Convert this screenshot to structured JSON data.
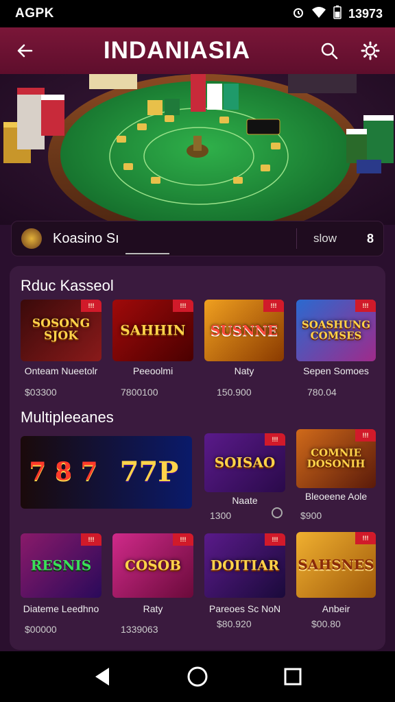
{
  "status_bar": {
    "carrier": "AGPK",
    "time": "13973"
  },
  "app_bar": {
    "title": "INDANIASIA"
  },
  "search": {
    "label": "Koasino Sı",
    "sort": "slow",
    "count": "8"
  },
  "sections": [
    {
      "title": "Rduc Kasseol",
      "games": [
        {
          "logo": "SOSONG\nSJOK",
          "badge": "!!!",
          "name": "Onteam Nueetolr",
          "price": "$03300"
        },
        {
          "logo": "SAHHIN",
          "badge": "!!!",
          "name": "Peeoolmi",
          "price": "7800100"
        },
        {
          "logo": "SUSNNE",
          "badge": "!!!",
          "name": "Naty",
          "price": "150.900"
        },
        {
          "logo": "SOASHUNG\nCOMSES",
          "badge": "!!!",
          "name": "Sepen Somoes",
          "price": "780.04"
        }
      ]
    },
    {
      "title": "Multipleeanes",
      "games": [
        {
          "logo": "7 8 7",
          "name": "",
          "price": ""
        },
        {
          "logo": "77P",
          "name": "",
          "price": ""
        },
        {
          "logo": "SOISAO",
          "badge": "!!!",
          "name": "Naate",
          "price": "1300"
        },
        {
          "logo": "COMNIE\nDOSONIH",
          "badge": "!!!",
          "name": "Bleoeene Aole",
          "price": "$900"
        },
        {
          "logo": "RESNIS",
          "badge": "!!!",
          "name": "Diateme Leedhno",
          "price": "$00000"
        },
        {
          "logo": "COSOB",
          "badge": "!!!",
          "name": "Raty",
          "price": "1339063"
        },
        {
          "logo": "DOITIAR",
          "badge": "!!!",
          "name": "Pareoes Sc NoN",
          "price": "$80.920"
        },
        {
          "logo": "SAHSNES",
          "badge": "!!!",
          "name": "Anbeir",
          "price": "$00.80"
        }
      ]
    }
  ],
  "colors": {
    "app_bar": "#7a1638",
    "panel": "#3a1a3e",
    "badge": "#d11a2a",
    "felt": "#1f8a3a"
  }
}
